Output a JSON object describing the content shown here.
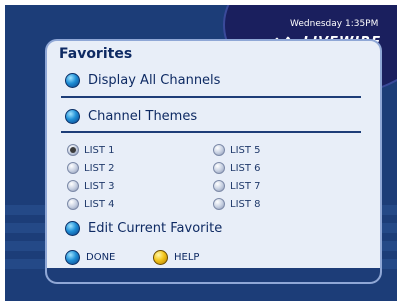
{
  "header": {
    "datetime": "Wednesday 1:35PM",
    "logo": "LIVEWIRE"
  },
  "panel": {
    "title": "Favorites",
    "menu": {
      "display_all": "Display All Channels",
      "channel_themes": "Channel Themes",
      "edit_current": "Edit Current Favorite"
    },
    "lists_left": [
      "LIST 1",
      "LIST 2",
      "LIST 3",
      "LIST 4"
    ],
    "lists_right": [
      "LIST 5",
      "LIST 6",
      "LIST 7",
      "LIST 8"
    ],
    "selected_list": "LIST 1"
  },
  "footer": {
    "done": "DONE",
    "help": "HELP"
  },
  "colors": {
    "screen_background": "#1c3d78",
    "panel_background": "#e8eef8",
    "accent_blue": "#1f8fd6",
    "accent_yellow": "#f3c51a"
  }
}
